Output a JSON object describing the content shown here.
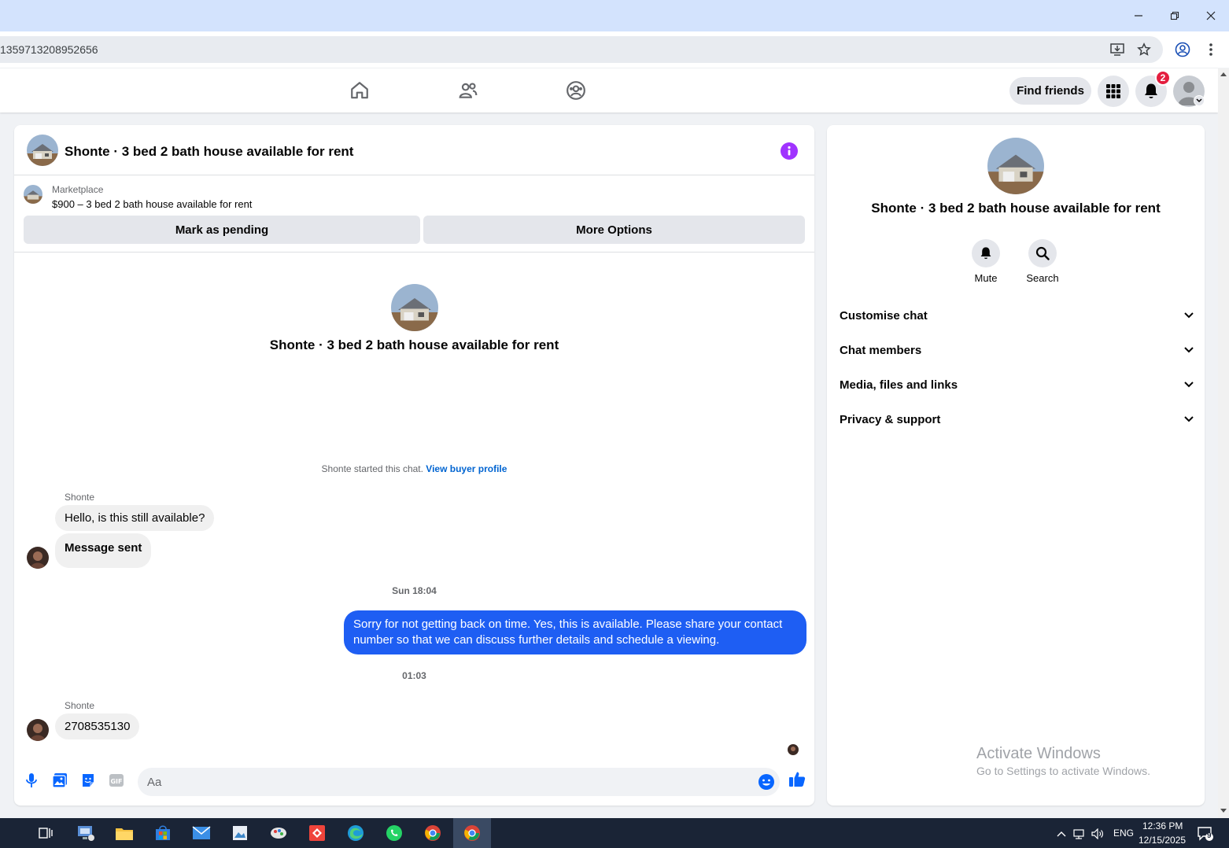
{
  "browser": {
    "url": "1359713208952656"
  },
  "fb_nav": {
    "find_friends_label": "Find friends",
    "notification_count": "2"
  },
  "chat": {
    "title": "Shonte · 3 bed 2 bath house available for rent",
    "marketplace_label": "Marketplace",
    "listing_text": "$900 – 3 bed 2 bath house available for rent",
    "mark_pending_label": "Mark as pending",
    "more_options_label": "More Options",
    "center_title": "Shonte · 3 bed 2 bath house available for rent",
    "started_text": "Shonte started this chat. ",
    "view_profile_label": "View buyer profile",
    "messages": [
      {
        "sender": "Shonte",
        "text": "Hello, is this still available?"
      },
      {
        "text": "Message sent"
      },
      {
        "timestamp": "Sun 18:04"
      },
      {
        "text": "Sorry for not getting back on time. Yes, this is available. Please share your contact number so that we can discuss further details and schedule a viewing."
      },
      {
        "timestamp": "01:03"
      },
      {
        "sender": "Shonte",
        "text": "2708535130"
      }
    ],
    "composer_placeholder": "Aa"
  },
  "right_panel": {
    "title": "Shonte · 3 bed 2 bath house available for rent",
    "mute_label": "Mute",
    "search_label": "Search",
    "sections": [
      "Customise chat",
      "Chat members",
      "Media, files and links",
      "Privacy & support"
    ],
    "activate_title": "Activate Windows",
    "activate_sub": "Go to Settings to activate Windows."
  },
  "taskbar": {
    "time": "12:36 PM",
    "date": "12/15/2025",
    "lang": "ENG",
    "notif_count": "9"
  },
  "colors": {
    "outgoing_bubble": "#1e5ef3",
    "info_icon": "#a033ff",
    "notif_badge": "#e41e3f",
    "link": "#0064d1"
  }
}
